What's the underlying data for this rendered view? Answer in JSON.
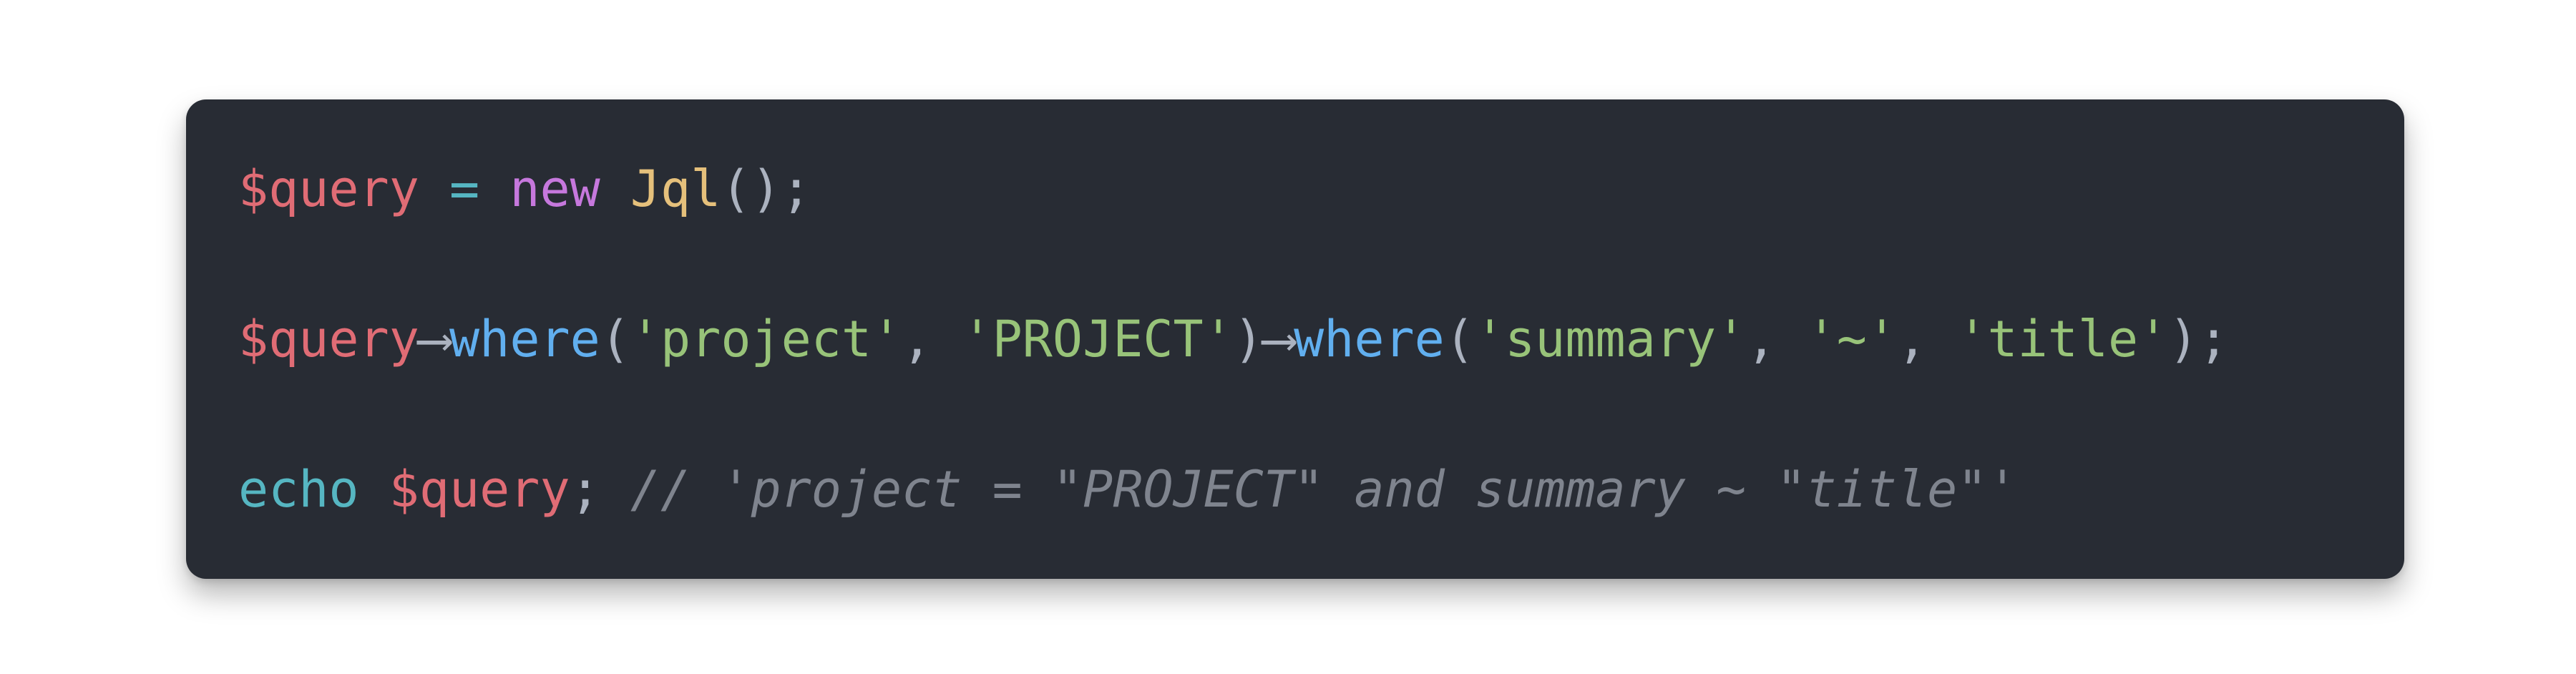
{
  "theme": {
    "background": "#282c34",
    "variable": "#e06c75",
    "operator": "#56b6c2",
    "keyword": "#c678dd",
    "class": "#e5c07b",
    "punctuation": "#abb2bf",
    "function": "#61afef",
    "string": "#98c379",
    "comment": "#7f848e"
  },
  "code": {
    "line1": {
      "var": "$query",
      "assign": " = ",
      "kw_new": "new",
      "sp": " ",
      "class": "Jql",
      "tail": "();"
    },
    "line2": {
      "var": "$query",
      "arrow1": "⟶",
      "fn1": "where",
      "open1": "(",
      "str1": "'project'",
      "comma1": ", ",
      "str2": "'PROJECT'",
      "close1": ")",
      "arrow2": "⟶",
      "fn2": "where",
      "open2": "(",
      "str3": "'summary'",
      "comma2": ", ",
      "str4": "'~'",
      "comma3": ", ",
      "str5": "'title'",
      "tail": ");"
    },
    "line3": {
      "echo": "echo",
      "sp": " ",
      "var": "$query",
      "semi": "; ",
      "comment": "// 'project = \"PROJECT\" and summary ~ \"title\"'"
    }
  }
}
